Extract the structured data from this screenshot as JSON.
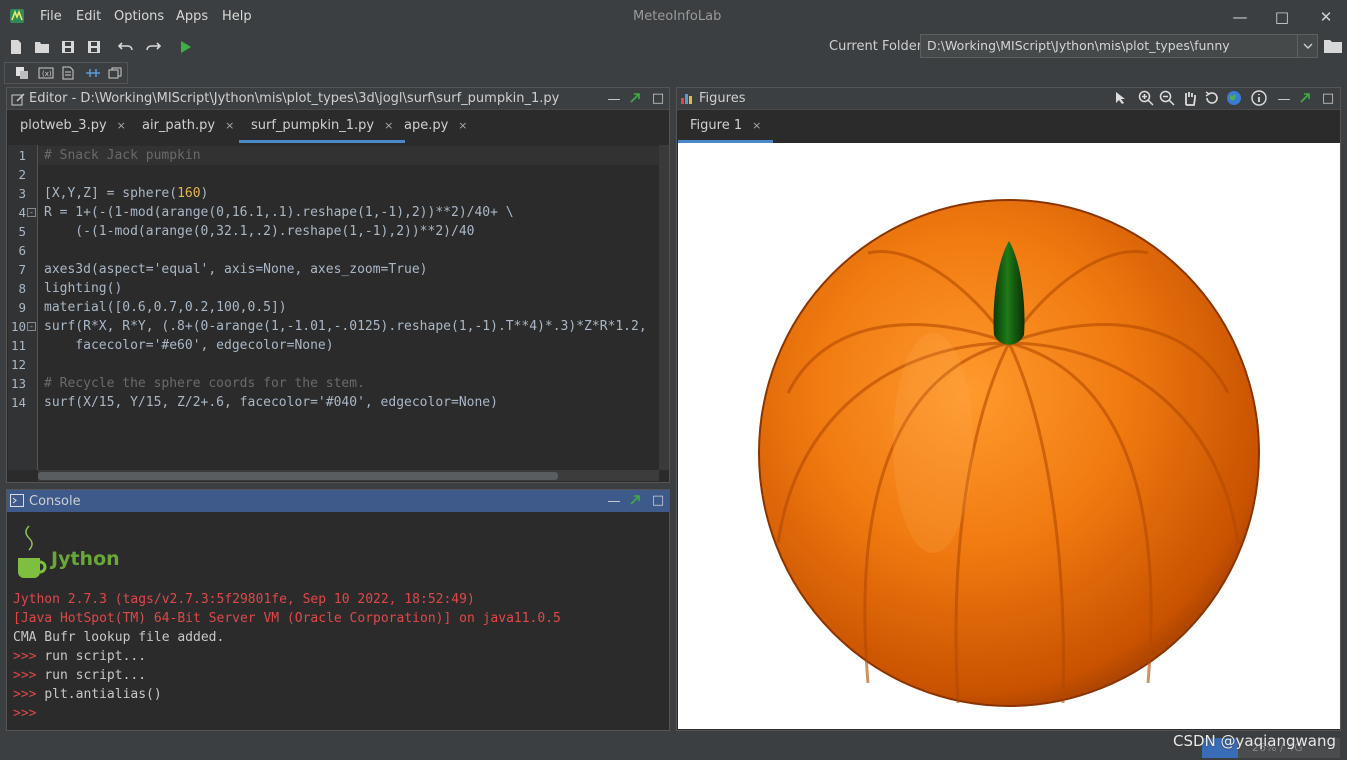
{
  "app": {
    "title": "MeteoInfoLab",
    "menu": [
      "File",
      "Edit",
      "Options",
      "Apps",
      "Help"
    ]
  },
  "toolbar": {
    "current_folder_label": "Current Folder:",
    "current_folder_value": "D:\\Working\\MIScript\\Jython\\mis\\plot_types\\funny"
  },
  "editor": {
    "title": "Editor - D:\\Working\\MIScript\\Jython\\mis\\plot_types\\3d\\jogl\\surf\\surf_pumpkin_1.py",
    "tabs": [
      {
        "label": "plotweb_3.py",
        "close": "×"
      },
      {
        "label": "air_path.py",
        "close": "×"
      },
      {
        "label": "surf_pumpkin_1.py",
        "close": "×"
      },
      {
        "label": "ape.py",
        "close": "×"
      }
    ],
    "line_numbers": [
      "1",
      "2",
      "3",
      "4",
      "5",
      "6",
      "7",
      "8",
      "9",
      "10",
      "11",
      "12",
      "13",
      "14"
    ],
    "code": {
      "l1": "# Snack Jack pumpkin",
      "l3a": "[X,Y,Z] = sphere(",
      "l3b": "160",
      "l3c": ")",
      "l4": "R = 1+(-(1-mod(arange(0,16.1,.1).reshape(1,-1),2))**2)/40+ \\",
      "l5": "    (-(1-mod(arange(0,32.1,.2).reshape(1,-1),2))**2)/40",
      "l7": "axes3d(aspect='equal', axis=None, axes_zoom=True)",
      "l8": "lighting()",
      "l9": "material([0.6,0.7,0.2,100,0.5])",
      "l10": "surf(R*X, R*Y, (.8+(0-arange(1,-1.01,-.0125).reshape(1,-1).T**4)*.3)*Z*R*1.2,",
      "l11": "    facecolor='#e60', edgecolor=None)",
      "l13": "# Recycle the sphere coords for the stem.",
      "l14": "surf(X/15, Y/15, Z/2+.6, facecolor='#040', edgecolor=None)"
    }
  },
  "console": {
    "title": "Console",
    "logo_text": "Jython",
    "lines": [
      "Jython 2.7.3 (tags/v2.7.3:5f29801fe, Sep 10 2022, 18:52:49)",
      "[Java HotSpot(TM) 64-Bit Server VM (Oracle Corporation)] on java11.0.5",
      "CMA Bufr lookup file added."
    ],
    "prompt": ">>>",
    "commands": [
      "run script...",
      "run script...",
      "plt.antialias()",
      ""
    ]
  },
  "figures": {
    "title": "Figures",
    "tab": "Figure 1",
    "tab_close": "×",
    "pumpkin_color": "#ee6600",
    "stem_color": "#004400"
  },
  "status": {
    "memory": "26% / 4G",
    "memory_fraction": 0.26,
    "watermark": "CSDN @yaqiangwang"
  },
  "colors": {
    "accent": "#4a88c7",
    "console_header": "#3d5a8a",
    "run_green": "#3cb043"
  }
}
